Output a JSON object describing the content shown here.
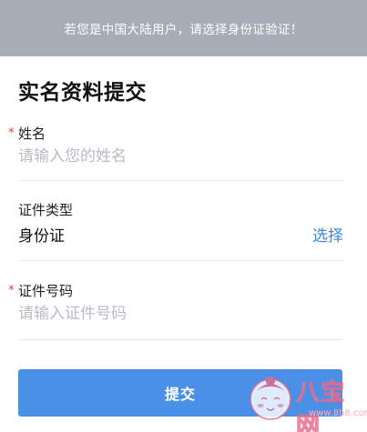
{
  "notice": {
    "text": "若您是中国大陆用户，请选择身份证验证！"
  },
  "form": {
    "title": "实名资料提交",
    "name_field": {
      "required_mark": "*",
      "label": "姓名",
      "placeholder": "请输入您的姓名",
      "value": ""
    },
    "id_type_field": {
      "label": "证件类型",
      "value": "身份证",
      "select_label": "选择"
    },
    "id_number_field": {
      "required_mark": "*",
      "label": "证件号码",
      "placeholder": "请输入证件号码",
      "value": ""
    },
    "submit_label": "提交"
  },
  "watermark": {
    "brand_text": "八宝网",
    "url": "www.8b8.com"
  },
  "colors": {
    "notice_bg": "#a6adb6",
    "accent": "#3a86e0",
    "submit_bg": "#4a90e6",
    "required": "#e0463c",
    "placeholder": "#b8bcc2"
  }
}
